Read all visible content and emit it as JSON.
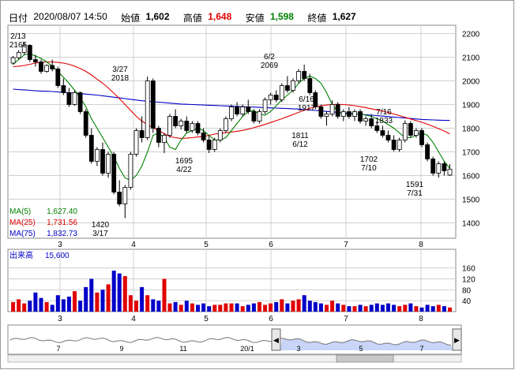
{
  "header": {
    "date_label": "日付",
    "date_value": "2020/08/07 14:50",
    "open_label": "始値",
    "open_value": "1,602",
    "high_label": "高値",
    "high_value": "1,648",
    "low_label": "安値",
    "low_value": "1,598",
    "close_label": "終値",
    "close_value": "1,627"
  },
  "colors": {
    "up": "#ffffff",
    "down": "#000000",
    "ma5": "#008000",
    "ma25": "#e00000",
    "ma75": "#0000c8",
    "volume": "#e00000",
    "volume_alt": "#0000c8",
    "grid": "#d0d0d0",
    "high_value": "#e00000",
    "low_value": "#008000",
    "navigator_fill": "#c8d4f8"
  },
  "legend": {
    "ma5_label": "MA(5)",
    "ma5_value": "1,627.40",
    "ma25_label": "MA(25)",
    "ma25_value": "1,731.56",
    "ma75_label": "MA(75)",
    "ma75_value": "1,832.73"
  },
  "volume_panel": {
    "title": "出来高",
    "value": "15,600",
    "ticks": [
      "160",
      "120",
      "80",
      "40"
    ]
  },
  "navigator": {
    "month_labels": [
      "7",
      "9",
      "11",
      "20/1",
      "3",
      "5",
      "7"
    ],
    "left_arrow": "◀",
    "right_arrow": "▶"
  },
  "chart_data": {
    "type": "candlestick",
    "price_axis": {
      "ticks": [
        2200,
        2100,
        2000,
        1900,
        1800,
        1700,
        1600,
        1500,
        1400
      ],
      "ylim": [
        1335,
        2235
      ]
    },
    "volume_axis": {
      "ticks": [
        160,
        120,
        80,
        40
      ],
      "ylim": [
        0,
        185
      ]
    },
    "x_month_labels": [
      "3",
      "4",
      "5",
      "6",
      "7",
      "8"
    ],
    "annotations": [
      {
        "date": "2/13",
        "value": "2165",
        "position": "above"
      },
      {
        "date": "3/27",
        "value": "2018",
        "position": "above"
      },
      {
        "date": "1420",
        "value": "3/17",
        "position": "below"
      },
      {
        "date": "1695",
        "value": "4/22",
        "position": "below"
      },
      {
        "date": "6/2",
        "value": "2069",
        "position": "above"
      },
      {
        "date": "6/16",
        "value": "1917",
        "position": "above"
      },
      {
        "date": "1811",
        "value": "6/12",
        "position": "below"
      },
      {
        "date": "7/16",
        "value": "1833",
        "position": "above"
      },
      {
        "date": "1702",
        "value": "7/10",
        "position": "below"
      },
      {
        "date": "1591",
        "value": "7/31",
        "position": "below"
      }
    ],
    "candles": [
      [
        2075,
        2105,
        2068,
        2098
      ],
      [
        2098,
        2130,
        2090,
        2120
      ],
      [
        2120,
        2165,
        2110,
        2150
      ],
      [
        2150,
        2155,
        2080,
        2090
      ],
      [
        2090,
        2110,
        2060,
        2080
      ],
      [
        2080,
        2090,
        2030,
        2040
      ],
      [
        2040,
        2070,
        2035,
        2065
      ],
      [
        2065,
        2090,
        2040,
        2050
      ],
      [
        2050,
        2060,
        1970,
        1980
      ],
      [
        1980,
        2010,
        1940,
        1950
      ],
      [
        1950,
        1970,
        1890,
        1900
      ],
      [
        1900,
        1960,
        1895,
        1950
      ],
      [
        1950,
        1955,
        1860,
        1870
      ],
      [
        1870,
        1880,
        1760,
        1770
      ],
      [
        1770,
        1800,
        1650,
        1660
      ],
      [
        1660,
        1720,
        1640,
        1710
      ],
      [
        1710,
        1740,
        1600,
        1610
      ],
      [
        1610,
        1700,
        1590,
        1690
      ],
      [
        1690,
        1700,
        1520,
        1530
      ],
      [
        1530,
        1580,
        1470,
        1480
      ],
      [
        1480,
        1560,
        1420,
        1550
      ],
      [
        1550,
        1700,
        1540,
        1690
      ],
      [
        1690,
        1800,
        1680,
        1790
      ],
      [
        1790,
        1850,
        1740,
        1760
      ],
      [
        1760,
        2018,
        1750,
        2000
      ],
      [
        2000,
        2010,
        1780,
        1800
      ],
      [
        1800,
        1810,
        1720,
        1740
      ],
      [
        1740,
        1780,
        1695,
        1770
      ],
      [
        1770,
        1860,
        1760,
        1850
      ],
      [
        1850,
        1880,
        1800,
        1810
      ],
      [
        1810,
        1840,
        1795,
        1830
      ],
      [
        1830,
        1850,
        1780,
        1790
      ],
      [
        1790,
        1830,
        1780,
        1820
      ],
      [
        1820,
        1830,
        1770,
        1780
      ],
      [
        1780,
        1800,
        1740,
        1750
      ],
      [
        1750,
        1770,
        1695,
        1710
      ],
      [
        1710,
        1760,
        1700,
        1750
      ],
      [
        1750,
        1800,
        1740,
        1790
      ],
      [
        1790,
        1850,
        1780,
        1840
      ],
      [
        1840,
        1900,
        1830,
        1890
      ],
      [
        1890,
        1910,
        1850,
        1860
      ],
      [
        1860,
        1900,
        1850,
        1890
      ],
      [
        1890,
        1920,
        1860,
        1870
      ],
      [
        1870,
        1880,
        1820,
        1830
      ],
      [
        1830,
        1880,
        1820,
        1870
      ],
      [
        1870,
        1930,
        1860,
        1920
      ],
      [
        1920,
        1950,
        1900,
        1940
      ],
      [
        1940,
        1960,
        1910,
        1920
      ],
      [
        1920,
        1990,
        1910,
        1980
      ],
      [
        1980,
        2020,
        1950,
        1960
      ],
      [
        1960,
        2010,
        1950,
        2000
      ],
      [
        2000,
        2050,
        1990,
        2040
      ],
      [
        2040,
        2069,
        2000,
        2010
      ],
      [
        2010,
        2030,
        1940,
        1950
      ],
      [
        1950,
        1960,
        1880,
        1890
      ],
      [
        1890,
        1900,
        1840,
        1850
      ],
      [
        1850,
        1870,
        1811,
        1860
      ],
      [
        1860,
        1917,
        1850,
        1900
      ],
      [
        1900,
        1910,
        1840,
        1850
      ],
      [
        1850,
        1880,
        1830,
        1870
      ],
      [
        1870,
        1890,
        1840,
        1850
      ],
      [
        1850,
        1880,
        1830,
        1870
      ],
      [
        1870,
        1880,
        1820,
        1830
      ],
      [
        1830,
        1850,
        1810,
        1840
      ],
      [
        1840,
        1860,
        1800,
        1810
      ],
      [
        1810,
        1830,
        1780,
        1790
      ],
      [
        1790,
        1810,
        1760,
        1770
      ],
      [
        1770,
        1790,
        1740,
        1750
      ],
      [
        1750,
        1770,
        1702,
        1710
      ],
      [
        1710,
        1760,
        1700,
        1750
      ],
      [
        1750,
        1833,
        1740,
        1820
      ],
      [
        1820,
        1830,
        1760,
        1770
      ],
      [
        1770,
        1800,
        1760,
        1790
      ],
      [
        1790,
        1800,
        1720,
        1730
      ],
      [
        1730,
        1740,
        1660,
        1670
      ],
      [
        1670,
        1680,
        1600,
        1610
      ],
      [
        1610,
        1660,
        1591,
        1650
      ],
      [
        1650,
        1660,
        1600,
        1620
      ],
      [
        1602,
        1648,
        1598,
        1627
      ]
    ],
    "ma5": [
      2070,
      2090,
      2110,
      2115,
      2105,
      2095,
      2080,
      2062,
      2040,
      2015,
      1990,
      1960,
      1930,
      1890,
      1840,
      1800,
      1760,
      1720,
      1680,
      1630,
      1590,
      1580,
      1600,
      1640,
      1700,
      1770,
      1780,
      1760,
      1720,
      1710,
      1750,
      1780,
      1790,
      1800,
      1790,
      1770,
      1750,
      1750,
      1760,
      1790,
      1820,
      1850,
      1870,
      1875,
      1860,
      1855,
      1870,
      1895,
      1920,
      1940,
      1960,
      1990,
      2010,
      2020,
      2010,
      1990,
      1950,
      1900,
      1870,
      1860,
      1860,
      1860,
      1860,
      1855,
      1850,
      1840,
      1830,
      1815,
      1800,
      1780,
      1760,
      1760,
      1770,
      1780,
      1770,
      1740,
      1700,
      1660,
      1630
    ],
    "ma25": [
      2060,
      2062,
      2065,
      2070,
      2075,
      2078,
      2080,
      2080,
      2078,
      2075,
      2070,
      2062,
      2052,
      2040,
      2025,
      2007,
      1990,
      1970,
      1948,
      1925,
      1900,
      1875,
      1850,
      1830,
      1815,
      1802,
      1790,
      1777,
      1765,
      1760,
      1757,
      1758,
      1760,
      1763,
      1765,
      1770,
      1775,
      1778,
      1781,
      1784,
      1787,
      1791,
      1796,
      1802,
      1809,
      1816,
      1824,
      1832,
      1840,
      1849,
      1858,
      1867,
      1876,
      1884,
      1890,
      1895,
      1898,
      1900,
      1901,
      1900,
      1898,
      1895,
      1891,
      1887,
      1882,
      1877,
      1872,
      1866,
      1860,
      1853,
      1846,
      1839,
      1832,
      1825,
      1817,
      1808,
      1798,
      1788,
      1776
    ],
    "ma75": [
      1965,
      1963,
      1962,
      1960,
      1958,
      1957,
      1956,
      1955,
      1953,
      1952,
      1950,
      1948,
      1946,
      1944,
      1942,
      1940,
      1937,
      1934,
      1931,
      1928,
      1925,
      1922,
      1919,
      1916,
      1914,
      1912,
      1910,
      1908,
      1906,
      1904,
      1902,
      1901,
      1900,
      1899,
      1898,
      1897,
      1896,
      1895,
      1894,
      1893,
      1892,
      1891,
      1890,
      1889,
      1888,
      1887,
      1886,
      1885,
      1884,
      1883,
      1882,
      1881,
      1879,
      1877,
      1875,
      1873,
      1871,
      1869,
      1867,
      1865,
      1863,
      1861,
      1859,
      1857,
      1855,
      1853,
      1851,
      1849,
      1847,
      1845,
      1843,
      1841,
      1839,
      1837,
      1836,
      1835,
      1834,
      1833,
      1833
    ],
    "volume": [
      35,
      45,
      30,
      40,
      70,
      50,
      35,
      25,
      60,
      45,
      55,
      75,
      40,
      90,
      120,
      70,
      80,
      100,
      150,
      140,
      130,
      60,
      40,
      90,
      60,
      45,
      40,
      120,
      30,
      35,
      25,
      40,
      30,
      25,
      30,
      20,
      25,
      25,
      30,
      30,
      30,
      20,
      25,
      30,
      35,
      25,
      30,
      35,
      45,
      30,
      40,
      45,
      60,
      40,
      35,
      30,
      25,
      40,
      30,
      25,
      20,
      20,
      25,
      20,
      25,
      30,
      25,
      30,
      25,
      20,
      25,
      30,
      20,
      15,
      25,
      20,
      25,
      20,
      15
    ]
  }
}
